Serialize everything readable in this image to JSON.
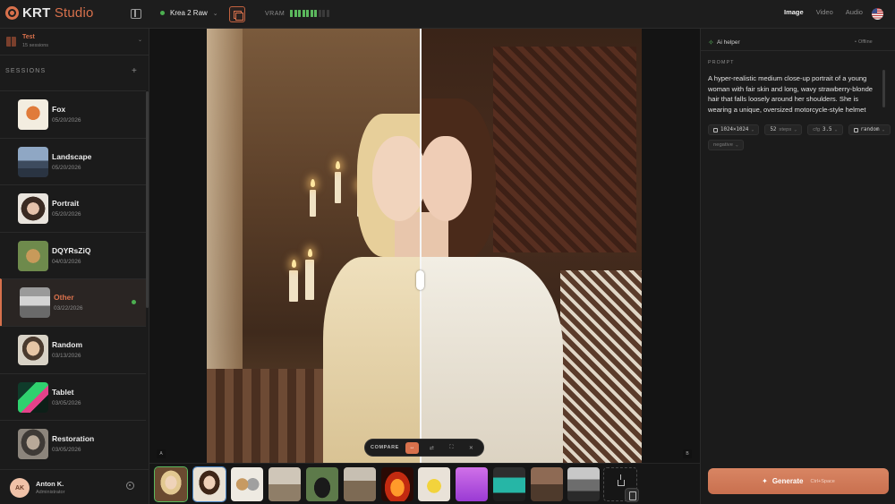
{
  "app": {
    "logo_main": "KRT",
    "logo_accent": "Studio",
    "model": "Krea 2 Raw",
    "vram_label": "VRAM",
    "vram_level_bars_on": 7,
    "vram_level_bars_total": 10,
    "tabs": [
      {
        "label": "Image",
        "active": true
      },
      {
        "label": "Video",
        "active": false
      },
      {
        "label": "Audio",
        "active": false
      }
    ]
  },
  "sidebar": {
    "project": {
      "name": "Test",
      "sub": "15 sessions"
    },
    "sessions_heading": "SESSIONS",
    "sessions": [
      {
        "name": "Fox",
        "date": "05/20/2026",
        "active": false
      },
      {
        "name": "Landscape",
        "date": "05/20/2026",
        "active": false
      },
      {
        "name": "Portrait",
        "date": "05/20/2026",
        "active": false
      },
      {
        "name": "DQYRsZiQ",
        "date": "04/03/2026",
        "active": false
      },
      {
        "name": "Other",
        "date": "03/22/2026",
        "active": true
      },
      {
        "name": "Random",
        "date": "03/13/2026",
        "active": false
      },
      {
        "name": "Tablet",
        "date": "03/05/2026",
        "active": false
      },
      {
        "name": "Restoration",
        "date": "03/05/2026",
        "active": false
      }
    ],
    "user": {
      "initials": "AK",
      "name": "Anton K.",
      "role": "Administrator"
    }
  },
  "canvas": {
    "marker_a": "A",
    "marker_b": "B",
    "compare_label": "COMPARE",
    "divider_position": 0.49
  },
  "right_panel": {
    "title": "Ai helper",
    "status": "Offline",
    "prompt_label": "PROMPT",
    "prompt": "A hyper-realistic medium close-up portrait of a young woman with fair skin and long, wavy strawberry-blonde hair that falls loosely around her shoulders. She is wearing a unique, oversized motorcycle-style helmet",
    "chips": {
      "size": "1024×1024",
      "steps_value": "52",
      "steps_unit": "steps",
      "cfg_label": "cfg",
      "cfg_value": "3.5",
      "seed": "random",
      "negative": "negative"
    },
    "generate_label": "Generate",
    "generate_hint": "Ctrl+Space"
  },
  "colors": {
    "accent": "#d8714c",
    "online": "#5bb85d",
    "background": "#171717"
  }
}
